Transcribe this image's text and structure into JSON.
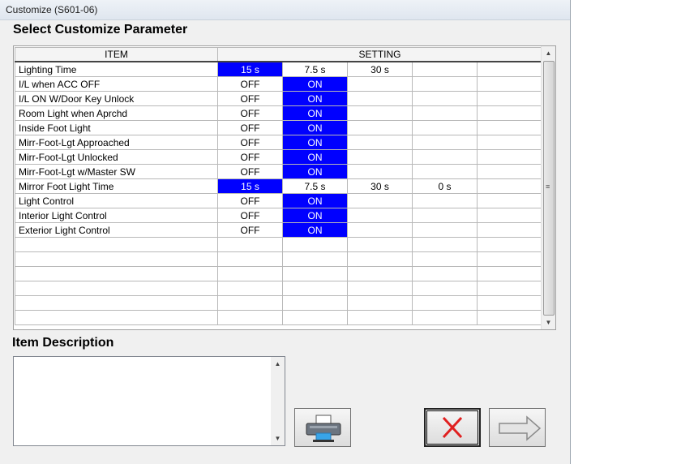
{
  "window": {
    "title": "Customize (S601-06)"
  },
  "heading": "Select Customize Parameter",
  "grid": {
    "columns": {
      "item": "ITEM",
      "setting": "SETTING"
    },
    "rows": [
      {
        "item": "Lighting Time",
        "values": [
          "15 s",
          "7.5 s",
          "30 s",
          "",
          ""
        ],
        "selected": 0
      },
      {
        "item": "I/L when ACC OFF",
        "values": [
          "OFF",
          "ON",
          "",
          "",
          ""
        ],
        "selected": 1
      },
      {
        "item": "I/L ON W/Door Key Unlock",
        "values": [
          "OFF",
          "ON",
          "",
          "",
          ""
        ],
        "selected": 1
      },
      {
        "item": "Room Light when Aprchd",
        "values": [
          "OFF",
          "ON",
          "",
          "",
          ""
        ],
        "selected": 1
      },
      {
        "item": "Inside Foot Light",
        "values": [
          "OFF",
          "ON",
          "",
          "",
          ""
        ],
        "selected": 1
      },
      {
        "item": "Mirr-Foot-Lgt Approached",
        "values": [
          "OFF",
          "ON",
          "",
          "",
          ""
        ],
        "selected": 1
      },
      {
        "item": "Mirr-Foot-Lgt Unlocked",
        "values": [
          "OFF",
          "ON",
          "",
          "",
          ""
        ],
        "selected": 1
      },
      {
        "item": "Mirr-Foot-Lgt w/Master SW",
        "values": [
          "OFF",
          "ON",
          "",
          "",
          ""
        ],
        "selected": 1
      },
      {
        "item": "Mirror Foot Light Time",
        "values": [
          "15 s",
          "7.5 s",
          "30 s",
          "0 s",
          ""
        ],
        "selected": 0
      },
      {
        "item": "Light Control",
        "values": [
          "OFF",
          "ON",
          "",
          "",
          ""
        ],
        "selected": 1
      },
      {
        "item": "Interior Light Control",
        "values": [
          "OFF",
          "ON",
          "",
          "",
          ""
        ],
        "selected": 1
      },
      {
        "item": "Exterior Light Control",
        "values": [
          "OFF",
          "ON",
          "",
          "",
          ""
        ],
        "selected": 1
      },
      {
        "item": "",
        "values": [
          "",
          "",
          "",
          "",
          ""
        ],
        "selected": -1
      },
      {
        "item": "",
        "values": [
          "",
          "",
          "",
          "",
          ""
        ],
        "selected": -1
      },
      {
        "item": "",
        "values": [
          "",
          "",
          "",
          "",
          ""
        ],
        "selected": -1
      },
      {
        "item": "",
        "values": [
          "",
          "",
          "",
          "",
          ""
        ],
        "selected": -1
      },
      {
        "item": "",
        "values": [
          "",
          "",
          "",
          "",
          ""
        ],
        "selected": -1
      },
      {
        "item": "",
        "values": [
          "",
          "",
          "",
          "",
          ""
        ],
        "selected": -1
      }
    ]
  },
  "description": {
    "label": "Item Description",
    "text": ""
  },
  "buttons": {
    "print": "printer-icon",
    "cancel": "close-x-icon",
    "next": "arrow-right-icon"
  },
  "colors": {
    "selected_bg": "#0000ff",
    "selected_fg": "#ffffff",
    "cancel_red": "#e02020"
  }
}
